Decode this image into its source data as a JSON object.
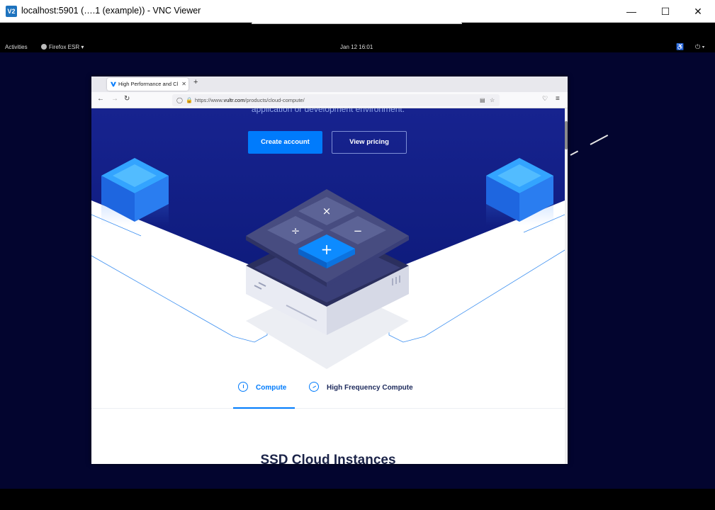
{
  "vnc": {
    "logo": "V2",
    "title": "localhost:5901 (….1 (example)) - VNC Viewer",
    "minimize_glyph": "—",
    "maximize_glyph": "☐",
    "close_glyph": "✕"
  },
  "gnome": {
    "activities": "Activities",
    "app_menu": "Firefox ESR ▾",
    "clock": "Jan 12  16:01",
    "accessibility_glyph": "♿",
    "power_glyph": "⏻ ▾"
  },
  "firefox": {
    "tab_title": "High Performance and Cl",
    "tab_close": "✕",
    "new_tab": "+",
    "back": "←",
    "forward": "→",
    "reload": "↻",
    "url_prefix": "https://www.",
    "url_domain": "vultr.com",
    "url_path": "/products/cloud-compute/",
    "reader_glyph": "▤",
    "bookmark_glyph": "☆",
    "pocket_glyph": "♡",
    "menu_glyph": "≡"
  },
  "page": {
    "hero_subtext": "application or development environment.",
    "create_account": "Create account",
    "view_pricing": "View pricing",
    "tabs": [
      {
        "label": "Compute",
        "active": true
      },
      {
        "label": "High Frequency Compute",
        "active": false
      }
    ],
    "section_heading": "SSD Cloud Instances"
  },
  "colors": {
    "accent": "#007bfc",
    "hero_dark": "#0d1a7a",
    "desktop": "#03052f"
  }
}
